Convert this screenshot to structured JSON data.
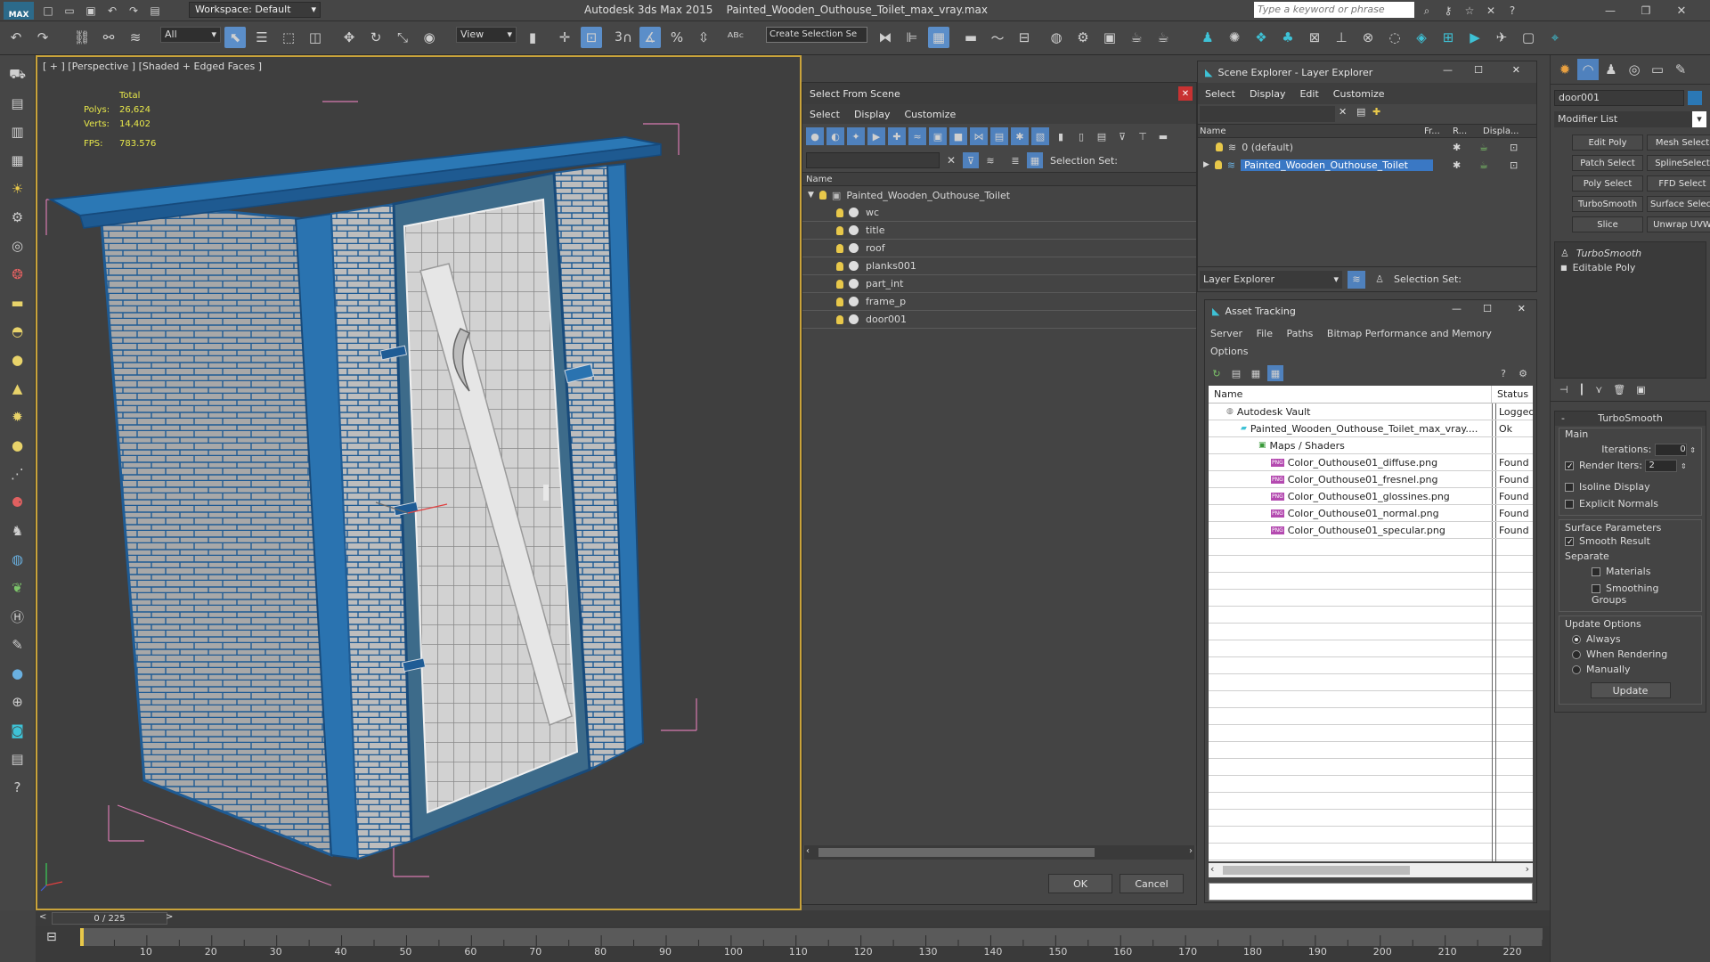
{
  "titlebar": {
    "app_title": "Autodesk 3ds Max  2015",
    "file_title": "Painted_Wooden_Outhouse_Toilet_max_vray.max",
    "workspace": "Workspace: Default",
    "search_placeholder": "Type a keyword or phrase"
  },
  "toolbar": {
    "filter_value": "All",
    "ref_coord": "View",
    "selection_set_placeholder": "Create Selection Se",
    "snap_label": "3"
  },
  "viewport": {
    "label": "[ + ] [Perspective ] [Shaded + Edged Faces ]",
    "stats_total": "Total",
    "polys_label": "Polys:",
    "polys_value": "26,624",
    "verts_label": "Verts:",
    "verts_value": "14,402",
    "fps_label": "FPS:",
    "fps_value": "783.576"
  },
  "select_from_scene": {
    "title": "Select From Scene",
    "menu": [
      "Select",
      "Display",
      "Customize"
    ],
    "selection_set_label": "Selection Set:",
    "column_name": "Name",
    "root": "Painted_Wooden_Outhouse_Toilet",
    "items": [
      "wc",
      "title",
      "roof",
      "planks001",
      "part_int",
      "frame_p",
      "door001"
    ],
    "ok": "OK",
    "cancel": "Cancel"
  },
  "scene_explorer": {
    "title": "Scene Explorer - Layer Explorer",
    "menu": [
      "Select",
      "Display",
      "Edit",
      "Customize"
    ],
    "col_name": "Name",
    "col_fr": "Fr...",
    "col_r": "R...",
    "col_disp": "Displa...",
    "layers": [
      "0 (default)",
      "Painted_Wooden_Outhouse_Toilet"
    ],
    "footer_dropdown": "Layer Explorer",
    "selection_set_label": "Selection Set:"
  },
  "asset_tracking": {
    "title": "Asset Tracking",
    "menu": [
      "Server",
      "File",
      "Paths",
      "Bitmap Performance and Memory"
    ],
    "menu2": "Options",
    "col_name": "Name",
    "col_status": "Status",
    "rows": [
      {
        "name": "Autodesk Vault",
        "status": "Logged"
      },
      {
        "name": "Painted_Wooden_Outhouse_Toilet_max_vray....",
        "status": "Ok"
      },
      {
        "name": "Maps / Shaders",
        "status": ""
      },
      {
        "name": "Color_Outhouse01_diffuse.png",
        "status": "Found"
      },
      {
        "name": "Color_Outhouse01_fresnel.png",
        "status": "Found"
      },
      {
        "name": "Color_Outhouse01_glossines.png",
        "status": "Found"
      },
      {
        "name": "Color_Outhouse01_normal.png",
        "status": "Found"
      },
      {
        "name": "Color_Outhouse01_specular.png",
        "status": "Found"
      }
    ]
  },
  "command_panel": {
    "object_name": "door001",
    "modifier_list": "Modifier List",
    "buttons": [
      "Edit Poly",
      "Mesh Select",
      "Patch Select",
      "SplineSelect",
      "Poly Select",
      "FFD Select",
      "TurboSmooth",
      "Surface Select",
      "Slice",
      "Unwrap UVW"
    ],
    "stack": [
      "TurboSmooth",
      "Editable Poly"
    ],
    "rollout_title": "TurboSmooth",
    "main_label": "Main",
    "iterations_label": "Iterations:",
    "iterations_value": "0",
    "render_iters_label": "Render Iters:",
    "render_iters_value": "2",
    "isoline": "Isoline Display",
    "explicit_normals": "Explicit Normals",
    "surface_params": "Surface Parameters",
    "smooth_result": "Smooth Result",
    "separate": "Separate",
    "materials": "Materials",
    "smoothing_groups": "Smoothing Groups",
    "update_options": "Update Options",
    "always": "Always",
    "when_rendering": "When Rendering",
    "manually": "Manually",
    "update_btn": "Update"
  },
  "timeline": {
    "frame": "0 / 225",
    "ticks": [
      "10",
      "20",
      "30",
      "40",
      "50",
      "60",
      "70",
      "80",
      "90",
      "100",
      "110",
      "120",
      "130",
      "140",
      "150",
      "160",
      "170",
      "180",
      "190",
      "200",
      "210",
      "220"
    ]
  }
}
